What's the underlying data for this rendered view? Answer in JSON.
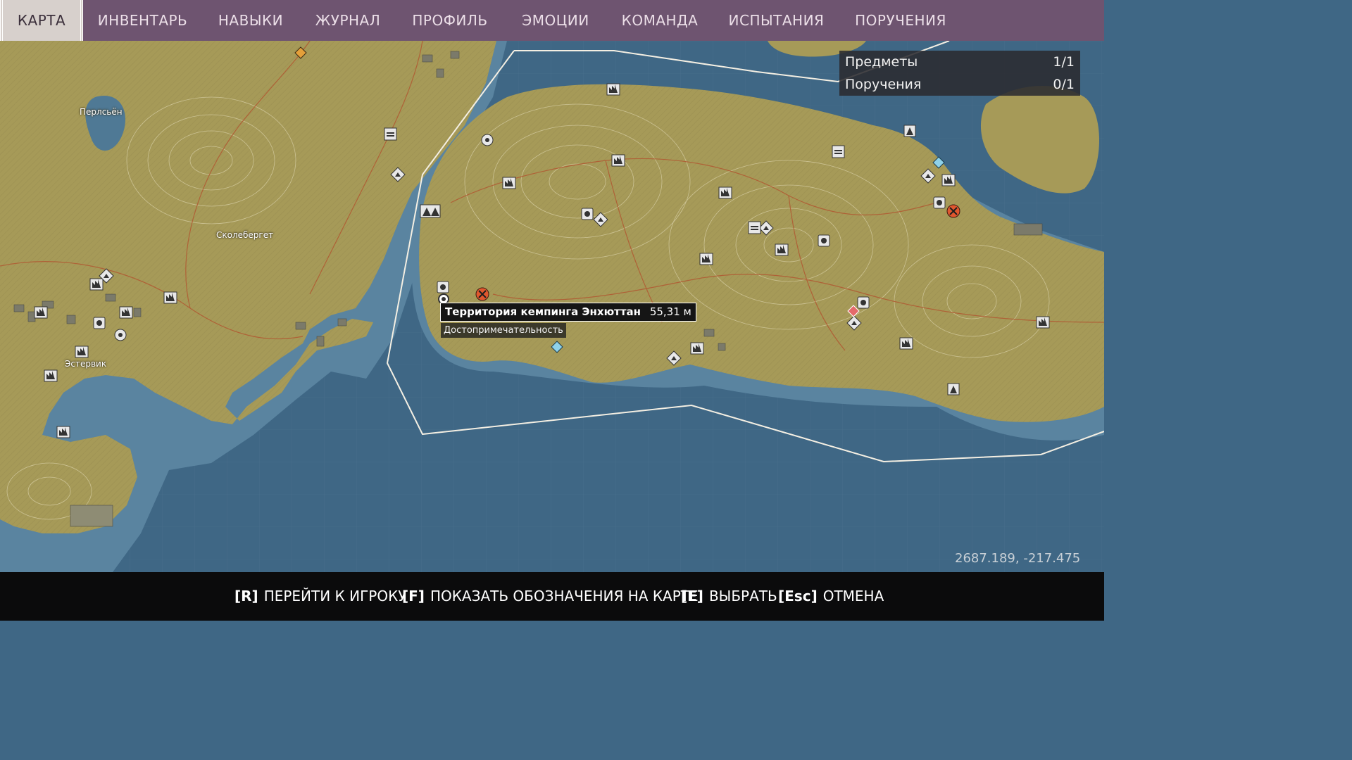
{
  "tabs": [
    {
      "label": "КАРТА",
      "active": true
    },
    {
      "label": "ИНВЕНТАРЬ"
    },
    {
      "label": "НАВЫКИ"
    },
    {
      "label": "ЖУРНАЛ"
    },
    {
      "label": "ПРОФИЛЬ"
    },
    {
      "label": "ЭМОЦИИ"
    },
    {
      "label": "КОМАНДА"
    },
    {
      "label": "ИСПЫТАНИЯ"
    },
    {
      "label": "ПОРУЧЕНИЯ"
    }
  ],
  "objectives": [
    {
      "label": "Предметы",
      "count": "1/1"
    },
    {
      "label": "Поручения",
      "count": "0/1"
    }
  ],
  "map": {
    "places": [
      "Перлсьён",
      "Сколебергет",
      "Эстервик"
    ],
    "tooltip": {
      "name": "Территория кемпинга Энхюттан",
      "distance": "55,31 м",
      "type": "Достопримечательность"
    },
    "coordinates": "2687.189, -217.475"
  },
  "hints": [
    {
      "key": "[R]",
      "label": "ПЕРЕЙТИ К ИГРОКУ"
    },
    {
      "key": "[F]",
      "label": "ПОКАЗАТЬ ОБОЗНАЧЕНИЯ НА КАРТЕ"
    },
    {
      "key": "[E]",
      "label": "ВЫБРАТЬ"
    },
    {
      "key": "[Esc]",
      "label": "ОТМЕНА"
    }
  ],
  "colors": {
    "topbar": "#6e5470",
    "water": "#3f6785",
    "land": "#a69a58",
    "objective_marker": "#e0572e",
    "boundary": "#f4efe3"
  },
  "icons": [
    "camera-icon",
    "factory-icon",
    "tent-icon",
    "house-icon",
    "diamond-marker-icon",
    "crossed-swords-icon",
    "player-marker-icon",
    "gear-icon"
  ]
}
